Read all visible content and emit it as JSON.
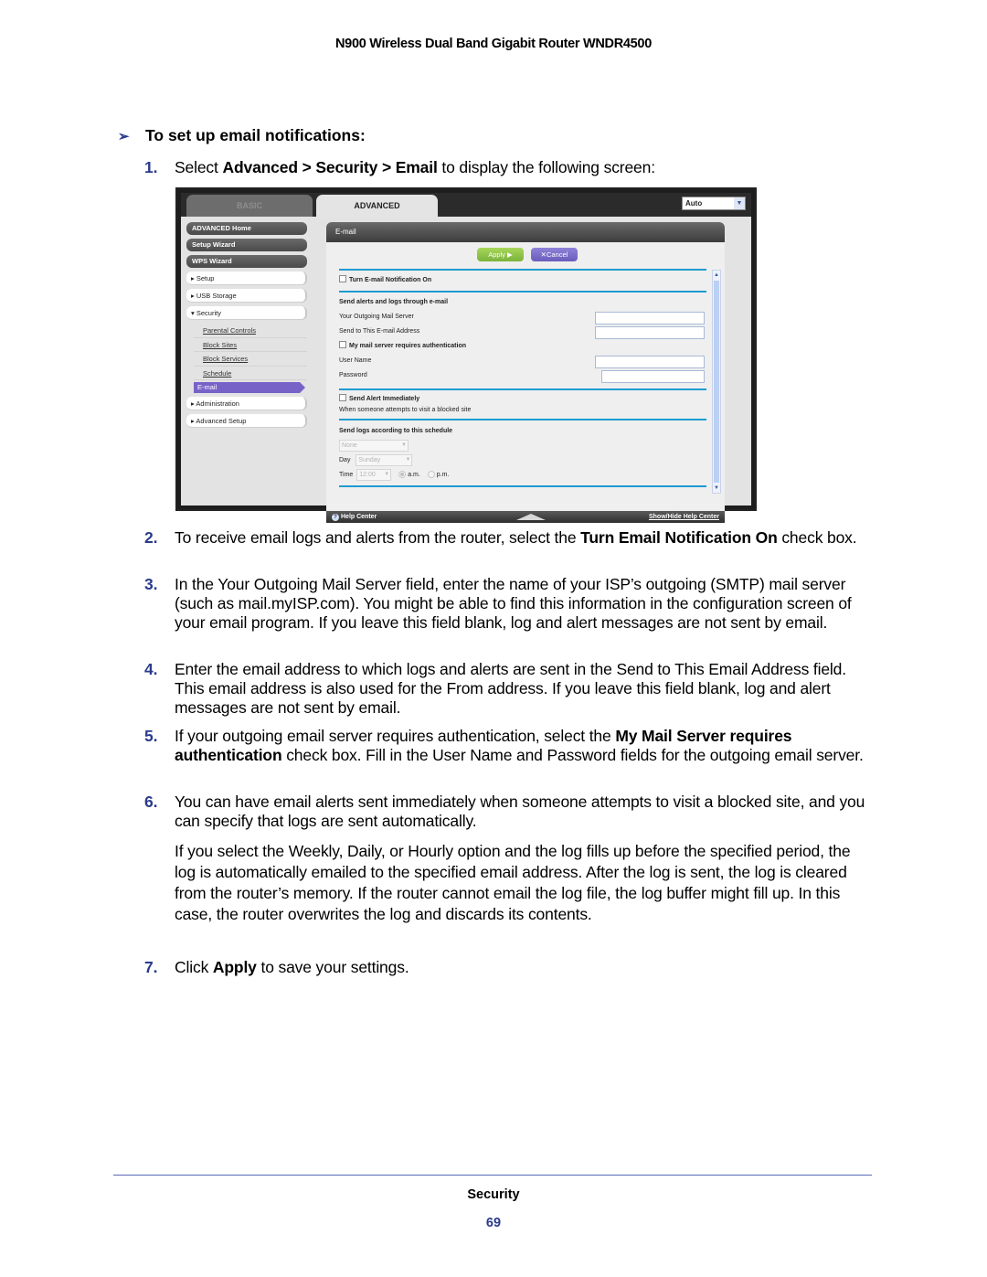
{
  "header": {
    "title": "N900 Wireless Dual Band Gigabit Router WNDR4500"
  },
  "task": {
    "icon": "arrow-bullet-icon",
    "heading": "To set up email notifications:"
  },
  "steps": [
    {
      "num": "1.",
      "parts": [
        "Select ",
        "Advanced > Security > Email",
        " to display the following screen:"
      ]
    },
    {
      "num": "2.",
      "parts": [
        "To receive email logs and alerts from the router, select the ",
        "Turn Email Notification On",
        " check box."
      ]
    },
    {
      "num": "3.",
      "text": "In the Your Outgoing Mail Server field, enter the name of your ISP’s outgoing (SMTP) mail server (such as mail.myISP.com). You might be able to find this information in the configuration screen of your email program. If you leave this field blank, log and alert messages are not sent by email."
    },
    {
      "num": "4.",
      "text": "Enter the email address to which logs and alerts are sent in the Send to This Email Address field. This email address is also used for the From address. If you leave this field blank, log and alert messages are not sent by email."
    },
    {
      "num": "5.",
      "parts": [
        "If your outgoing email server requires authentication, select the ",
        "My Mail Server requires authentication",
        " check box. Fill in the User Name and Password fields for the outgoing email server."
      ]
    },
    {
      "num": "6.",
      "text": "You can have email alerts sent immediately when someone attempts to visit a blocked site, and you can specify that logs are sent automatically."
    },
    {
      "num": "7.",
      "parts": [
        "Click ",
        "Apply",
        " to save your settings."
      ]
    }
  ],
  "step6_note": "If you select the Weekly, Daily, or Hourly option and the log fills up before the specified period, the log is automatically emailed to the specified email address. After the log is sent, the log is cleared from the router’s memory. If the router cannot email the log file, the log buffer might fill up. In this case, the router overwrites the log and discards its contents.",
  "router_ui": {
    "tabs": {
      "basic": "BASIC",
      "advanced": "ADVANCED"
    },
    "language_select": "Auto",
    "sidebar": {
      "dark_items": [
        "ADVANCED Home",
        "Setup Wizard",
        "WPS Wizard"
      ],
      "setup": "▸ Setup",
      "usb": "▸ USB Storage",
      "security": "▾ Security",
      "security_sub": [
        "Parental Controls",
        "Block Sites",
        "Block Services",
        "Schedule"
      ],
      "active": "E-mail",
      "administration": "▸ Administration",
      "advanced_setup": "▸ Advanced Setup"
    },
    "panel": {
      "title": "E-mail",
      "apply": "Apply ▶",
      "cancel": "✕Cancel",
      "turn_on_label": "Turn E-mail Notification On",
      "turn_on_checked": false,
      "send_heading": "Send alerts and logs through e-mail",
      "outgoing_label": "Your Outgoing Mail Server",
      "outgoing_value": "",
      "send_to_label": "Send to This E-mail Address",
      "send_to_value": "",
      "auth_label": "My mail server requires authentication",
      "auth_checked": false,
      "user_label": "User Name",
      "user_value": "",
      "password_label": "Password",
      "password_value": "",
      "alert_label": "Send Alert Immediately",
      "alert_checked": false,
      "alert_desc": "When someone attempts to visit a blocked site",
      "schedule_heading": "Send logs according to this schedule",
      "schedule_value": "None",
      "day_label": "Day",
      "day_value": "Sunday",
      "time_label": "Time",
      "time_value": "12:00",
      "am_label": "a.m.",
      "pm_label": "p.m.",
      "am_selected": true
    },
    "footer": {
      "help": "Help Center",
      "toggle": "Show/Hide Help Center"
    }
  },
  "page_footer": {
    "section": "Security",
    "page": "69"
  }
}
